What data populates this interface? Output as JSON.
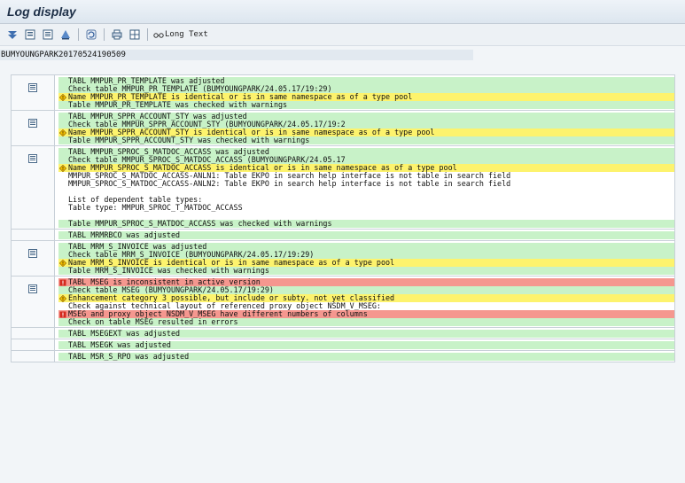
{
  "window": {
    "title": "Log display"
  },
  "toolbar": {
    "buttons": [
      "expand-all-icon",
      "collapse-icon",
      "detail-icon",
      "find-icon",
      "refresh-icon",
      "print-icon",
      "grid-icon"
    ],
    "long_text_label": "Long Text"
  },
  "log_id": "BUMYOUNGPARK20170524190509",
  "colors": {
    "success": "#c8f2c8",
    "warning": "#fdf36d",
    "error": "#f5978f"
  },
  "groups": [
    {
      "detail": true,
      "lines": [
        {
          "s": "g",
          "t": "TABL MMPUR_PR_TEMPLATE was adjusted"
        },
        {
          "s": "g",
          "t": "Check table MMPUR_PR_TEMPLATE (BUMYOUNGPARK/24.05.17/19:29)"
        },
        {
          "s": "y",
          "icon": "warning",
          "t": "Name MMPUR_PR_TEMPLATE is identical or is in same namespace as of a type pool"
        },
        {
          "s": "g",
          "t": "Table MMPUR_PR_TEMPLATE was checked with warnings"
        }
      ]
    },
    {
      "detail": true,
      "lines": [
        {
          "s": "g",
          "t": "TABL MMPUR_SPPR_ACCOUNT_STY was adjusted"
        },
        {
          "s": "g",
          "t": "Check table MMPUR_SPPR_ACCOUNT_STY (BUMYOUNGPARK/24.05.17/19:2"
        },
        {
          "s": "y",
          "icon": "warning",
          "t": "Name MMPUR_SPPR_ACCOUNT_STY is identical or is in same namespace as of a type pool"
        },
        {
          "s": "g",
          "t": "Table MMPUR_SPPR_ACCOUNT_STY was checked with warnings"
        }
      ]
    },
    {
      "detail": true,
      "lines": [
        {
          "s": "g",
          "t": "TABL MMPUR_SPROC_S_MATDOC_ACCASS was adjusted"
        },
        {
          "s": "g",
          "t": "Check table MMPUR_SPROC_S_MATDOC_ACCASS (BUMYOUNGPARK/24.05.17"
        },
        {
          "s": "y",
          "icon": "warning",
          "t": "Name MMPUR_SPROC_S_MATDOC_ACCASS is identical or is in same namespace as of a type pool"
        },
        {
          "s": "w",
          "t": "MMPUR_SPROC_S_MATDOC_ACCASS-ANLN1: Table EKPO in search help interface is not table in search field"
        },
        {
          "s": "w",
          "t": "MMPUR_SPROC_S_MATDOC_ACCASS-ANLN2: Table EKPO in search help interface is not table in search field"
        },
        {
          "s": "e",
          "t": ""
        },
        {
          "s": "w",
          "t": "List of dependent table types:"
        },
        {
          "s": "w",
          "t": "Table type: MMPUR_SPROC_T_MATDOC_ACCASS"
        },
        {
          "s": "e",
          "t": ""
        },
        {
          "s": "g",
          "t": "Table MMPUR_SPROC_S_MATDOC_ACCASS was checked with warnings"
        }
      ]
    },
    {
      "detail": false,
      "lines": [
        {
          "s": "g",
          "t": "TABL MRMRBCO was adjusted"
        }
      ]
    },
    {
      "detail": true,
      "lines": [
        {
          "s": "g",
          "t": "TABL MRM_S_INVOICE was adjusted"
        },
        {
          "s": "g",
          "t": "Check table MRM_S_INVOICE (BUMYOUNGPARK/24.05.17/19:29)"
        },
        {
          "s": "y",
          "icon": "warning",
          "t": "Name MRM_S_INVOICE is identical or is in same namespace as of a type pool"
        },
        {
          "s": "g",
          "t": "Table MRM_S_INVOICE was checked with warnings"
        }
      ]
    },
    {
      "detail": true,
      "lines": [
        {
          "s": "r",
          "icon": "error",
          "t": "TABL MSEG is inconsistent in active version"
        },
        {
          "s": "g",
          "t": "Check table MSEG (BUMYOUNGPARK/24.05.17/19:29)"
        },
        {
          "s": "y",
          "icon": "warning",
          "t": "Enhancement category 3 possible, but include or subty. not yet classified"
        },
        {
          "s": "w",
          "t": "Check against technical layout of referenced proxy object NSDM_V_MSEG:"
        },
        {
          "s": "r",
          "icon": "error",
          "t": "MSEG and proxy object NSDM_V_MSEG have different numbers of columns"
        },
        {
          "s": "g",
          "t": "Check on table MSEG resulted in errors"
        }
      ]
    },
    {
      "detail": false,
      "lines": [
        {
          "s": "g",
          "t": "TABL MSEGEXT was adjusted"
        }
      ]
    },
    {
      "detail": false,
      "lines": [
        {
          "s": "g",
          "t": "TABL MSEGK was adjusted"
        }
      ]
    },
    {
      "detail": false,
      "lines": [
        {
          "s": "g",
          "t": "TABL MSR_S_RPO was adjusted"
        }
      ]
    }
  ]
}
